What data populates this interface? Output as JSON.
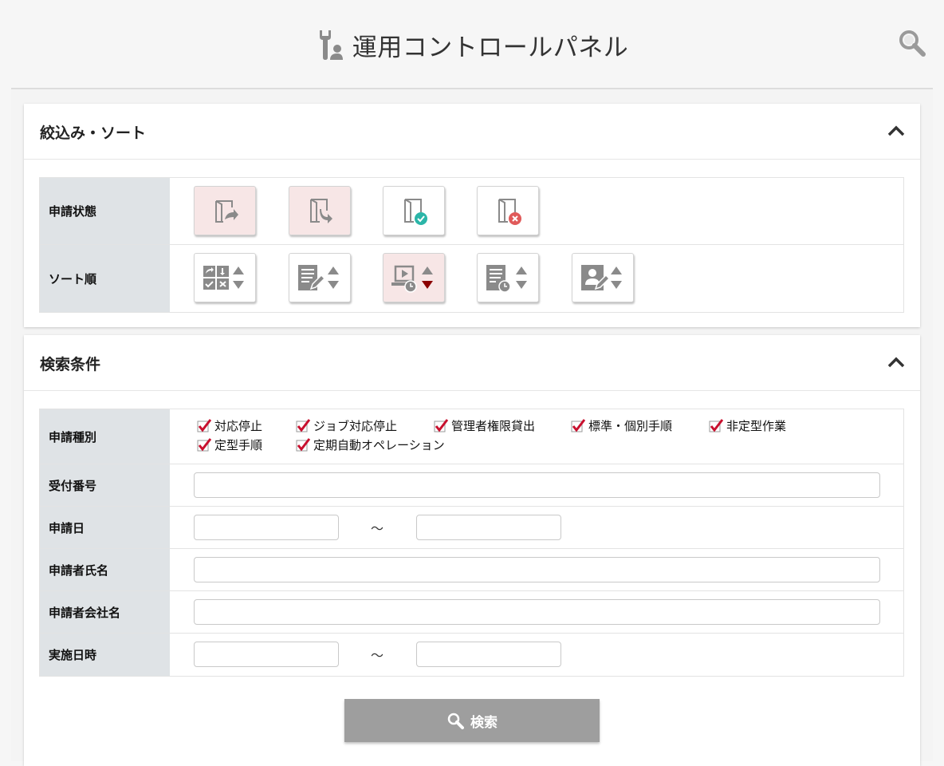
{
  "header": {
    "title": "運用コントロールパネル",
    "title_icon": "tools-user-icon",
    "search_icon": "search-icon"
  },
  "filter_panel": {
    "title": "絞込み・ソート",
    "collapse_icon": "chevron-up-icon",
    "status_row": {
      "label": "申請状態",
      "buttons": [
        {
          "name": "status-submitted-icon",
          "active": true
        },
        {
          "name": "status-received-icon",
          "active": true
        },
        {
          "name": "status-approved-icon",
          "active": false
        },
        {
          "name": "status-rejected-icon",
          "active": false
        }
      ]
    },
    "sort_row": {
      "label": "ソート順",
      "buttons": [
        {
          "name": "sort-type-icon",
          "active": false,
          "direction": "none"
        },
        {
          "name": "sort-document-edit-icon",
          "active": false,
          "direction": "none"
        },
        {
          "name": "sort-execution-time-icon",
          "active": true,
          "direction": "desc"
        },
        {
          "name": "sort-document-clock-icon",
          "active": false,
          "direction": "none"
        },
        {
          "name": "sort-applicant-edit-icon",
          "active": false,
          "direction": "none"
        }
      ]
    }
  },
  "search_panel": {
    "title": "検索条件",
    "collapse_icon": "chevron-up-icon",
    "request_type": {
      "label": "申請種別",
      "options": [
        {
          "label": "対応停止",
          "checked": true
        },
        {
          "label": "ジョブ対応停止",
          "checked": true
        },
        {
          "label": "管理者権限貸出",
          "checked": true
        },
        {
          "label": "標準・個別手順",
          "checked": true
        },
        {
          "label": "非定型作業",
          "checked": true
        },
        {
          "label": "定型手順",
          "checked": true
        },
        {
          "label": "定期自動オペレーション",
          "checked": true
        }
      ]
    },
    "receipt_no": {
      "label": "受付番号",
      "value": ""
    },
    "request_date": {
      "label": "申請日",
      "from": "",
      "to": "",
      "separator": "～"
    },
    "applicant_name": {
      "label": "申請者氏名",
      "value": ""
    },
    "applicant_company": {
      "label": "申請者会社名",
      "value": ""
    },
    "exec_datetime": {
      "label": "実施日時",
      "from": "",
      "to": "",
      "separator": "～"
    },
    "search_button": "検索"
  },
  "colors": {
    "active_bg": "#f7e6e6",
    "check_red": "#c8102e",
    "label_bg": "#dfe3e6",
    "button_gray": "#9e9e9e",
    "approved_teal": "#2bb5a8",
    "rejected_red": "#e05a5a",
    "sort_desc_red": "#8b0000"
  }
}
